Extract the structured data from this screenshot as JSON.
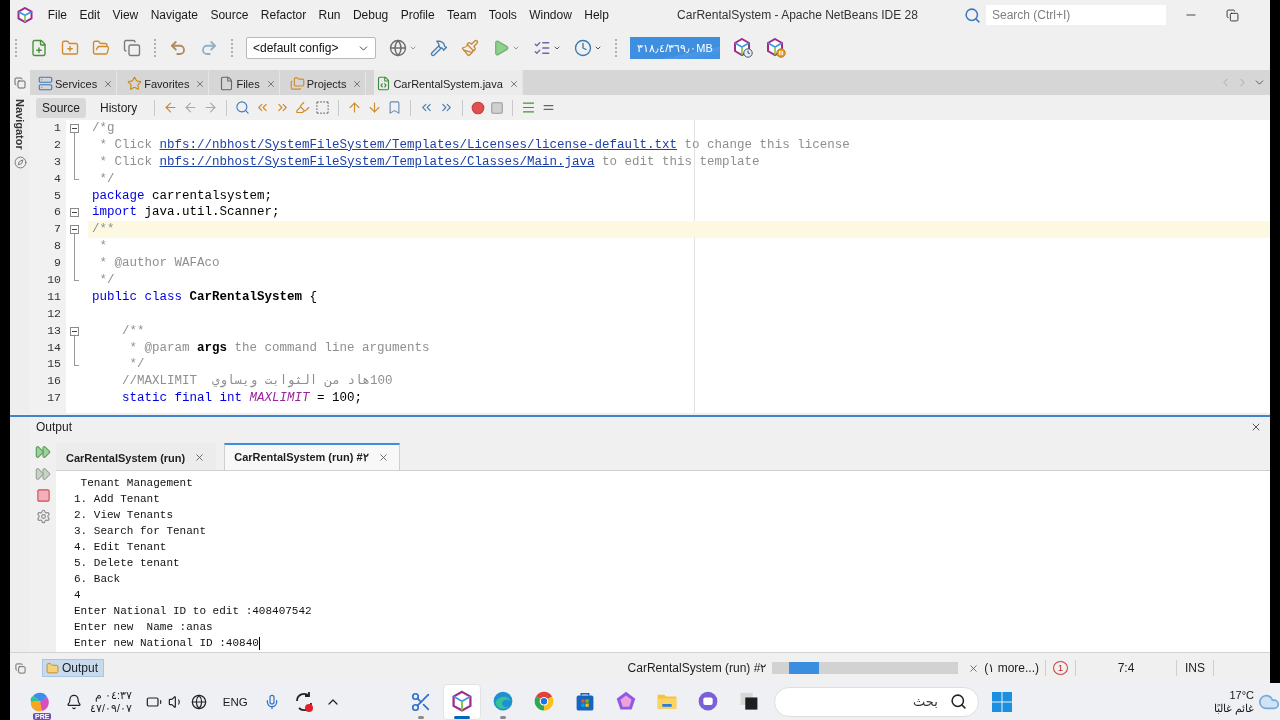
{
  "window": {
    "title": "CarRentalSystem - Apache NetBeans IDE 28",
    "search": {
      "placeholder": "Search (Ctrl+I)"
    }
  },
  "menu": [
    "File",
    "Edit",
    "View",
    "Navigate",
    "Source",
    "Refactor",
    "Run",
    "Debug",
    "Profile",
    "Team",
    "Tools",
    "Window",
    "Help"
  ],
  "toolbar": {
    "configuration": "<default config>",
    "memory": "٣١٨٫٤/٣٦٩٫٠MB"
  },
  "tool_tabs": [
    {
      "kind": "services",
      "label": "Services",
      "selected": false
    },
    {
      "kind": "favorites",
      "label": "Favorites",
      "selected": false
    },
    {
      "kind": "files",
      "label": "Files",
      "selected": false
    },
    {
      "kind": "projects",
      "label": "Projects",
      "selected": false
    },
    {
      "kind": "java",
      "label": "CarRentalSystem.java",
      "selected": true
    }
  ],
  "editor": {
    "navigator": "Navigator",
    "views": [
      {
        "label": "Source",
        "selected": true
      },
      {
        "label": "History",
        "selected": false
      }
    ],
    "lines": [
      {
        "number": "1",
        "kind": "fold_start",
        "current": false,
        "segments": [
          {
            "kind": "comment",
            "text": "/*g"
          }
        ]
      },
      {
        "number": "2",
        "kind": "fold_body",
        "current": false,
        "segments": [
          {
            "kind": "comment",
            "text": " * Click "
          },
          {
            "kind": "link",
            "text": "nbfs://nbhost/SystemFileSystem/Templates/Licenses/license-default.txt"
          },
          {
            "kind": "comment",
            "text": " to change this license"
          }
        ]
      },
      {
        "number": "3",
        "kind": "fold_body",
        "current": false,
        "segments": [
          {
            "kind": "comment",
            "text": " * Click "
          },
          {
            "kind": "link",
            "text": "nbfs://nbhost/SystemFileSystem/Templates/Classes/Main.java"
          },
          {
            "kind": "comment",
            "text": " to edit this template"
          }
        ]
      },
      {
        "number": "4",
        "kind": "fold_end",
        "current": false,
        "segments": [
          {
            "kind": "comment",
            "text": " */"
          }
        ]
      },
      {
        "number": "5",
        "kind": "plain",
        "current": false,
        "segments": [
          {
            "kind": "keyword",
            "text": "package"
          },
          {
            "kind": "plain",
            "text": " carrentalsystem;"
          }
        ]
      },
      {
        "number": "6",
        "kind": "fold_single",
        "current": false,
        "segments": [
          {
            "kind": "keyword",
            "text": "import"
          },
          {
            "kind": "plain",
            "text": " java.util.Scanner;"
          }
        ]
      },
      {
        "number": "7",
        "kind": "fold_start",
        "current": true,
        "segments": [
          {
            "kind": "comment",
            "text": "/**"
          }
        ]
      },
      {
        "number": "8",
        "kind": "fold_body",
        "current": false,
        "segments": [
          {
            "kind": "comment",
            "text": " *"
          }
        ]
      },
      {
        "number": "9",
        "kind": "fold_body",
        "current": false,
        "segments": [
          {
            "kind": "comment",
            "text": " * @author WAFAco"
          }
        ]
      },
      {
        "number": "10",
        "kind": "fold_end",
        "current": false,
        "segments": [
          {
            "kind": "comment",
            "text": " */"
          }
        ]
      },
      {
        "number": "11",
        "kind": "plain",
        "current": false,
        "segments": [
          {
            "kind": "keyword",
            "text": "public class"
          },
          {
            "kind": "classname",
            "text": " CarRentalSystem"
          },
          {
            "kind": "plain",
            "text": " {"
          }
        ]
      },
      {
        "number": "12",
        "kind": "plain",
        "current": false
      },
      {
        "number": "13",
        "kind": "fold_start",
        "current": false,
        "segments": [
          {
            "kind": "comment",
            "text": "    /**"
          }
        ]
      },
      {
        "number": "14",
        "kind": "fold_body",
        "current": false,
        "segments": [
          {
            "kind": "comment",
            "text": "     * @param "
          },
          {
            "kind": "param",
            "text": "args"
          },
          {
            "kind": "comment",
            "text": " the command line arguments"
          }
        ]
      },
      {
        "number": "15",
        "kind": "fold_end",
        "current": false,
        "segments": [
          {
            "kind": "comment",
            "text": "     */"
          }
        ]
      },
      {
        "number": "16",
        "kind": "plain",
        "current": false,
        "segments": [
          {
            "kind": "comment",
            "text": "    //MAXLIMIT  "
          },
          {
            "kind": "comment",
            "text": "100هاد من الثوابت ويساوي"
          }
        ]
      },
      {
        "number": "17",
        "kind": "plain",
        "current": false,
        "segments": [
          {
            "kind": "keyword",
            "text": "    static final int"
          },
          {
            "kind": "constant",
            "text": " MAXLIMIT"
          },
          {
            "kind": "plain",
            "text": " = 100;"
          }
        ]
      }
    ]
  },
  "output": {
    "title": "Output",
    "tabs": [
      {
        "label": "CarRentalSystem (run)",
        "selected": false
      },
      {
        "label": "CarRentalSystem (run) #٢",
        "selected": true
      }
    ],
    "lines": [
      {
        "text": " Tenant Management",
        "caret": false
      },
      {
        "text": "1. Add Tenant",
        "caret": false
      },
      {
        "text": "2. View Tenants",
        "caret": false
      },
      {
        "text": "3. Search for Tenant",
        "caret": false
      },
      {
        "text": "4. Edit Tenant",
        "caret": false
      },
      {
        "text": "5. Delete tenant",
        "caret": false
      },
      {
        "text": "6. Back",
        "caret": false
      },
      {
        "text": "4",
        "caret": false
      },
      {
        "text": "Enter National ID to edit :408407542",
        "caret": false
      },
      {
        "text": "Enter new  Name :anas",
        "caret": false
      },
      {
        "text": "Enter new National ID :40840",
        "caret": true
      }
    ]
  },
  "status_bar": {
    "windows": [
      {
        "label": "Output",
        "selected": true
      }
    ],
    "task": "CarRentalSystem (run) #٢",
    "progress": {
      "level": 0.16
    },
    "more": "(١ more...)",
    "notifications": "1",
    "caret_position": "7:4",
    "insert_mode": "INS"
  },
  "taskbar": {
    "widget_badge": "PRE",
    "time": "٠٤:٣٧ م",
    "date": "٤٧/٠٩/٠٧",
    "language": "ENG",
    "apps": [
      {
        "kind": "snipping",
        "running": true,
        "selected": false
      },
      {
        "kind": "netbeans",
        "running": true,
        "selected": true
      },
      {
        "kind": "edge",
        "running": true,
        "selected": false
      },
      {
        "kind": "chrome",
        "running": false,
        "selected": false
      },
      {
        "kind": "store",
        "running": false,
        "selected": false
      },
      {
        "kind": "copilot",
        "running": false,
        "selected": false
      },
      {
        "kind": "explorer",
        "running": false,
        "selected": false
      },
      {
        "kind": "chat",
        "running": false,
        "selected": false
      },
      {
        "kind": "terminal",
        "running": false,
        "selected": false
      }
    ],
    "search": {
      "placeholder": "بحث"
    },
    "weather": {
      "temperature": "17°C",
      "condition": "غائم غالبًا"
    }
  }
}
